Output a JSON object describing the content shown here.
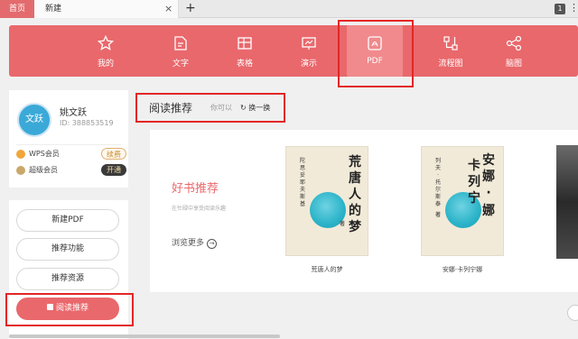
{
  "tabs": {
    "home": "首页",
    "new": "新建",
    "close": "×",
    "add": "+",
    "badge": "1",
    "more": "⋮"
  },
  "ribbon": {
    "items": [
      {
        "label": "我的",
        "icon": "star-icon"
      },
      {
        "label": "文字",
        "icon": "document-icon"
      },
      {
        "label": "表格",
        "icon": "table-icon"
      },
      {
        "label": "演示",
        "icon": "presentation-icon"
      },
      {
        "label": "PDF",
        "icon": "pdf-icon"
      },
      {
        "label": "流程图",
        "icon": "flowchart-icon"
      },
      {
        "label": "脑图",
        "icon": "mindmap-icon"
      }
    ],
    "active": "PDF"
  },
  "profile": {
    "avatar_text": "文跃",
    "name": "姚文跃",
    "id": "ID: 388853519",
    "wps_member": "WPS会员",
    "wps_action": "续费",
    "super_member": "超级会员",
    "super_action": "开通"
  },
  "actions": {
    "new_pdf": "新建PDF",
    "recommend_features": "推荐功能",
    "recommend_resources": "推荐资源",
    "reading_recommend": "阅读推荐"
  },
  "reading": {
    "title": "阅读推荐",
    "hint": "你可以",
    "refresh": "换一换",
    "good_title": "好书推荐",
    "good_subtitle": "在忙碌中享受阅读乐趣",
    "browse_more": "浏览更多"
  },
  "books": [
    {
      "title_chars": [
        "荒",
        "唐",
        "人",
        "的",
        "梦"
      ],
      "author_chars": [
        "陀",
        "思",
        "妥",
        "耶",
        "夫",
        "斯",
        "基"
      ],
      "author_mark": "著",
      "caption": "荒唐人的梦"
    },
    {
      "title_chars": [
        "安",
        "娜",
        "·",
        "卡",
        "列",
        "宁",
        "娜"
      ],
      "author_chars": [
        "列",
        "夫",
        "·",
        "托",
        "尔",
        "斯",
        "泰"
      ],
      "author_mark": "著",
      "caption": "安娜·卡列宁娜"
    }
  ],
  "colors": {
    "accent": "#e9686c",
    "annotation": "#e32626"
  }
}
